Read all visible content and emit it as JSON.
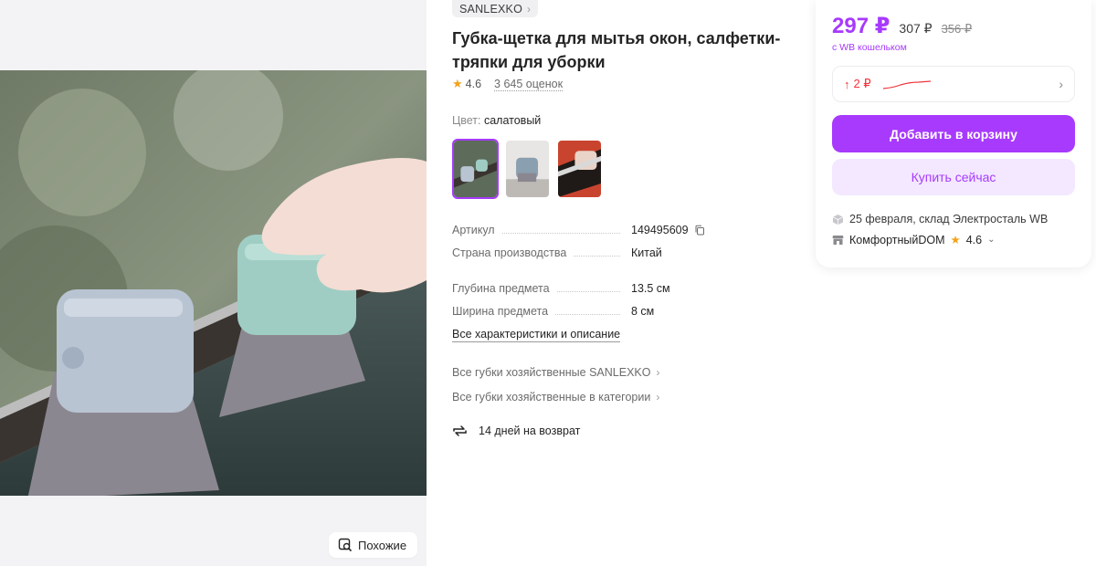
{
  "gallery": {
    "similar_label": "Похожие"
  },
  "product": {
    "brand": "SANLEXKO",
    "title": "Губка-щетка для мытья окон, салфетки-тряпки для уборки",
    "rating": "4.6",
    "reviews": "3 645 оценок",
    "color_label": "Цвет:",
    "color_value": "салатовый",
    "specs": [
      {
        "key": "Артикул",
        "value": "149495609"
      },
      {
        "key": "Страна производства",
        "value": "Китай"
      },
      {
        "key": "Глубина предмета",
        "value": "13.5 см"
      },
      {
        "key": "Ширина предмета",
        "value": "8 см"
      }
    ],
    "all_specs_link": "Все характеристики и описание",
    "brand_link": "Все губки хозяйственные SANLEXKO",
    "category_link": "Все губки хозяйственные в категории",
    "return_policy": "14 дней на возврат"
  },
  "buy_box": {
    "price": "297 ₽",
    "price_old": "307 ₽",
    "price_crossed": "356 ₽",
    "wallet_note": "с WB кошельком",
    "price_change": "2 ₽",
    "add_to_cart": "Добавить в корзину",
    "buy_now": "Купить сейчас",
    "delivery": "25 февраля, склад Электросталь WB",
    "seller_name": "КомфортныйDOM",
    "seller_rating": "4.6"
  },
  "colors": {
    "accent": "#a73afd",
    "accent_light": "#f3e8ff",
    "price_up": "#f0333a",
    "star": "#f4a21b"
  }
}
